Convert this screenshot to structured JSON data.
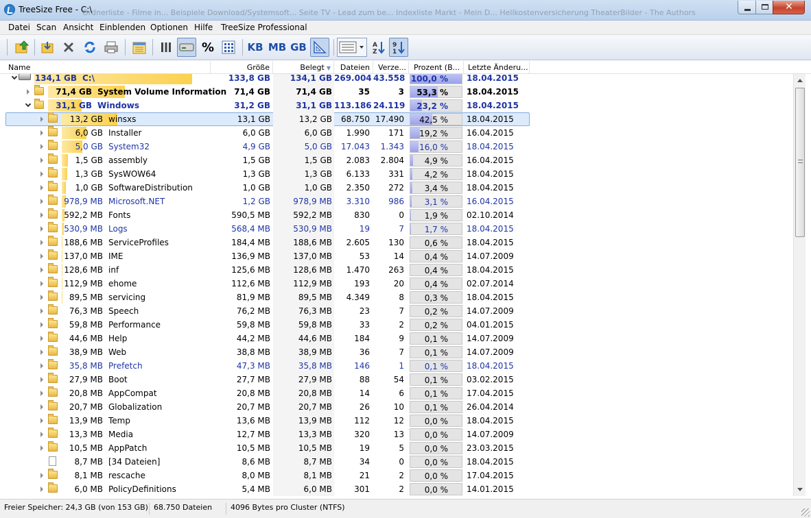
{
  "window": {
    "title": "TreeSize Free - C:\\",
    "background_tabs_text": "Ordnerliste - Filme in...    Beispiele    Download/Systemsoft...    Seite TV - Lead zum be...    Indexliste Markt - Mein D...    Hellkostenversicherung    TheaterBilder - The Authors"
  },
  "menu": [
    "Datei",
    "Scan",
    "Ansicht",
    "Einblenden",
    "Optionen",
    "Hilfe",
    "TreeSize Professional"
  ],
  "toolbar": {
    "unit_kb": "KB",
    "unit_mb": "MB",
    "unit_gb": "GB",
    "percent_label": "%"
  },
  "columns": {
    "name": "Name",
    "groesse": "Größe",
    "belegt": "Belegt",
    "dateien": "Dateien",
    "verzeichnisse": "Verze...",
    "prozent": "Prozent (B...",
    "letzte_aenderung": "Letzte Änderu..."
  },
  "rows": [
    {
      "level": 0,
      "type": "drive",
      "expander": "open",
      "size_label": "134,1 GB",
      "name": "C:\\",
      "groesse": "133,8 GB",
      "belegt": "134,1 GB",
      "dateien": "269.004",
      "verz": "43.558",
      "prozent": "100,0 %",
      "pct": 100,
      "datum": "18.04.2015",
      "bold": true,
      "blue": true,
      "bar": 100
    },
    {
      "level": 1,
      "type": "folder",
      "expander": "closed",
      "size_label": "71,4 GB",
      "name": "System Volume Information",
      "groesse": "71,4 GB",
      "belegt": "71,4 GB",
      "dateien": "35",
      "verz": "3",
      "prozent": "53,3 %",
      "pct": 53.3,
      "datum": "18.04.2015",
      "bold": true,
      "blue": false,
      "bar": 53.3
    },
    {
      "level": 1,
      "type": "folder",
      "expander": "open",
      "size_label": "31,1 GB",
      "name": "Windows",
      "groesse": "31,2 GB",
      "belegt": "31,1 GB",
      "dateien": "113.186",
      "verz": "24.119",
      "prozent": "23,2 %",
      "pct": 23.2,
      "datum": "18.04.2015",
      "bold": true,
      "blue": true,
      "bar": 23.2
    },
    {
      "level": 2,
      "type": "folder",
      "expander": "closed",
      "size_label": "13,2 GB",
      "name": "winsxs",
      "groesse": "13,1 GB",
      "belegt": "13,2 GB",
      "dateien": "68.750",
      "verz": "17.490",
      "prozent": "42,5 %",
      "pct": 42.5,
      "datum": "18.04.2015",
      "selected": true,
      "bar": 42.5
    },
    {
      "level": 2,
      "type": "folder",
      "expander": "closed",
      "size_label": "6,0 GB",
      "name": "Installer",
      "groesse": "6,0 GB",
      "belegt": "6,0 GB",
      "dateien": "1.990",
      "verz": "171",
      "prozent": "19,2 %",
      "pct": 19.2,
      "datum": "16.04.2015",
      "bar": 19.2
    },
    {
      "level": 2,
      "type": "folder",
      "expander": "closed",
      "size_label": "5,0 GB",
      "name": "System32",
      "groesse": "4,9 GB",
      "belegt": "5,0 GB",
      "dateien": "17.043",
      "verz": "1.343",
      "prozent": "16,0 %",
      "pct": 16.0,
      "datum": "18.04.2015",
      "blue": true,
      "bar": 16.0
    },
    {
      "level": 2,
      "type": "folder",
      "expander": "closed",
      "size_label": "1,5 GB",
      "name": "assembly",
      "groesse": "1,5 GB",
      "belegt": "1,5 GB",
      "dateien": "2.083",
      "verz": "2.804",
      "prozent": "4,9 %",
      "pct": 4.9,
      "datum": "16.04.2015",
      "bar": 4.9
    },
    {
      "level": 2,
      "type": "folder",
      "expander": "closed",
      "size_label": "1,3 GB",
      "name": "SysWOW64",
      "groesse": "1,3 GB",
      "belegt": "1,3 GB",
      "dateien": "6.133",
      "verz": "331",
      "prozent": "4,2 %",
      "pct": 4.2,
      "datum": "18.04.2015",
      "bar": 4.2
    },
    {
      "level": 2,
      "type": "folder",
      "expander": "closed",
      "size_label": "1,0 GB",
      "name": "SoftwareDistribution",
      "groesse": "1,0 GB",
      "belegt": "1,0 GB",
      "dateien": "2.350",
      "verz": "272",
      "prozent": "3,4 %",
      "pct": 3.4,
      "datum": "18.04.2015",
      "bar": 3.4
    },
    {
      "level": 2,
      "type": "folder",
      "expander": "closed",
      "size_label": "978,9 MB",
      "name": "Microsoft.NET",
      "groesse": "1,2 GB",
      "belegt": "978,9 MB",
      "dateien": "3.310",
      "verz": "986",
      "prozent": "3,1 %",
      "pct": 3.1,
      "datum": "16.04.2015",
      "blue": true,
      "bar": 3.1
    },
    {
      "level": 2,
      "type": "folder",
      "expander": "closed",
      "size_label": "592,2 MB",
      "name": "Fonts",
      "groesse": "590,5 MB",
      "belegt": "592,2 MB",
      "dateien": "830",
      "verz": "0",
      "prozent": "1,9 %",
      "pct": 1.9,
      "datum": "02.10.2014",
      "bar": 1.9
    },
    {
      "level": 2,
      "type": "folder",
      "expander": "closed",
      "size_label": "530,9 MB",
      "name": "Logs",
      "groesse": "568,4 MB",
      "belegt": "530,9 MB",
      "dateien": "19",
      "verz": "7",
      "prozent": "1,7 %",
      "pct": 1.7,
      "datum": "18.04.2015",
      "blue": true,
      "bar": 1.7
    },
    {
      "level": 2,
      "type": "folder",
      "expander": "closed",
      "size_label": "188,6 MB",
      "name": "ServiceProfiles",
      "groesse": "184,4 MB",
      "belegt": "188,6 MB",
      "dateien": "2.605",
      "verz": "130",
      "prozent": "0,6 %",
      "pct": 0.6,
      "datum": "18.04.2015",
      "bar": 0.6
    },
    {
      "level": 2,
      "type": "folder",
      "expander": "closed",
      "size_label": "137,0 MB",
      "name": "IME",
      "groesse": "136,9 MB",
      "belegt": "137,0 MB",
      "dateien": "53",
      "verz": "14",
      "prozent": "0,4 %",
      "pct": 0.4,
      "datum": "14.07.2009",
      "bar": 0.4
    },
    {
      "level": 2,
      "type": "folder",
      "expander": "closed",
      "size_label": "128,6 MB",
      "name": "inf",
      "groesse": "125,6 MB",
      "belegt": "128,6 MB",
      "dateien": "1.470",
      "verz": "263",
      "prozent": "0,4 %",
      "pct": 0.4,
      "datum": "18.04.2015",
      "bar": 0.4
    },
    {
      "level": 2,
      "type": "folder",
      "expander": "closed",
      "size_label": "112,9 MB",
      "name": "ehome",
      "groesse": "112,6 MB",
      "belegt": "112,9 MB",
      "dateien": "193",
      "verz": "20",
      "prozent": "0,4 %",
      "pct": 0.4,
      "datum": "02.07.2014",
      "bar": 0.4
    },
    {
      "level": 2,
      "type": "folder",
      "expander": "closed",
      "size_label": "89,5 MB",
      "name": "servicing",
      "groesse": "81,9 MB",
      "belegt": "89,5 MB",
      "dateien": "4.349",
      "verz": "8",
      "prozent": "0,3 %",
      "pct": 0.3,
      "datum": "18.04.2015",
      "bar": 0.3
    },
    {
      "level": 2,
      "type": "folder",
      "expander": "closed",
      "size_label": "76,3 MB",
      "name": "Speech",
      "groesse": "76,2 MB",
      "belegt": "76,3 MB",
      "dateien": "23",
      "verz": "7",
      "prozent": "0,2 %",
      "pct": 0.2,
      "datum": "14.07.2009",
      "bar": 0.2
    },
    {
      "level": 2,
      "type": "folder",
      "expander": "closed",
      "size_label": "59,8 MB",
      "name": "Performance",
      "groesse": "59,8 MB",
      "belegt": "59,8 MB",
      "dateien": "33",
      "verz": "2",
      "prozent": "0,2 %",
      "pct": 0.2,
      "datum": "04.01.2015",
      "bar": 0.2
    },
    {
      "level": 2,
      "type": "folder",
      "expander": "closed",
      "size_label": "44,6 MB",
      "name": "Help",
      "groesse": "44,2 MB",
      "belegt": "44,6 MB",
      "dateien": "184",
      "verz": "9",
      "prozent": "0,1 %",
      "pct": 0.1,
      "datum": "14.07.2009",
      "bar": 0.1
    },
    {
      "level": 2,
      "type": "folder",
      "expander": "closed",
      "size_label": "38,9 MB",
      "name": "Web",
      "groesse": "38,8 MB",
      "belegt": "38,9 MB",
      "dateien": "36",
      "verz": "7",
      "prozent": "0,1 %",
      "pct": 0.1,
      "datum": "14.07.2009",
      "bar": 0.1
    },
    {
      "level": 2,
      "type": "folder",
      "expander": "closed",
      "size_label": "35,8 MB",
      "name": "Prefetch",
      "groesse": "47,3 MB",
      "belegt": "35,8 MB",
      "dateien": "146",
      "verz": "1",
      "prozent": "0,1 %",
      "pct": 0.1,
      "datum": "18.04.2015",
      "blue": true,
      "bar": 0.1
    },
    {
      "level": 2,
      "type": "folder",
      "expander": "closed",
      "size_label": "27,9 MB",
      "name": "Boot",
      "groesse": "27,7 MB",
      "belegt": "27,9 MB",
      "dateien": "88",
      "verz": "54",
      "prozent": "0,1 %",
      "pct": 0.1,
      "datum": "03.02.2015",
      "bar": 0.1
    },
    {
      "level": 2,
      "type": "folder",
      "expander": "closed",
      "size_label": "20,8 MB",
      "name": "AppCompat",
      "groesse": "20,8 MB",
      "belegt": "20,8 MB",
      "dateien": "14",
      "verz": "6",
      "prozent": "0,1 %",
      "pct": 0.1,
      "datum": "17.04.2015",
      "bar": 0.1
    },
    {
      "level": 2,
      "type": "folder",
      "expander": "closed",
      "size_label": "20,7 MB",
      "name": "Globalization",
      "groesse": "20,7 MB",
      "belegt": "20,7 MB",
      "dateien": "26",
      "verz": "10",
      "prozent": "0,1 %",
      "pct": 0.1,
      "datum": "26.04.2014",
      "bar": 0.1
    },
    {
      "level": 2,
      "type": "folder",
      "expander": "closed",
      "size_label": "13,9 MB",
      "name": "Temp",
      "groesse": "13,6 MB",
      "belegt": "13,9 MB",
      "dateien": "112",
      "verz": "12",
      "prozent": "0,0 %",
      "pct": 0.0,
      "datum": "18.04.2015",
      "bar": 0.0
    },
    {
      "level": 2,
      "type": "folder",
      "expander": "closed",
      "size_label": "13,3 MB",
      "name": "Media",
      "groesse": "12,7 MB",
      "belegt": "13,3 MB",
      "dateien": "320",
      "verz": "13",
      "prozent": "0,0 %",
      "pct": 0.0,
      "datum": "14.07.2009",
      "bar": 0.0
    },
    {
      "level": 2,
      "type": "folder",
      "expander": "closed",
      "size_label": "10,5 MB",
      "name": "AppPatch",
      "groesse": "10,5 MB",
      "belegt": "10,5 MB",
      "dateien": "19",
      "verz": "5",
      "prozent": "0,0 %",
      "pct": 0.0,
      "datum": "23.03.2015",
      "bar": 0.0
    },
    {
      "level": 2,
      "type": "file",
      "expander": "none",
      "size_label": "8,7 MB",
      "name": "[34 Dateien]",
      "groesse": "8,6 MB",
      "belegt": "8,7 MB",
      "dateien": "34",
      "verz": "0",
      "prozent": "0,0 %",
      "pct": 0.0,
      "datum": "18.04.2015",
      "bar": 0.0
    },
    {
      "level": 2,
      "type": "folder",
      "expander": "closed",
      "size_label": "8,1 MB",
      "name": "rescache",
      "groesse": "8,0 MB",
      "belegt": "8,1 MB",
      "dateien": "21",
      "verz": "2",
      "prozent": "0,0 %",
      "pct": 0.0,
      "datum": "17.04.2015",
      "bar": 0.0
    },
    {
      "level": 2,
      "type": "folder",
      "expander": "closed",
      "size_label": "6,0 MB",
      "name": "PolicyDefinitions",
      "groesse": "5,4 MB",
      "belegt": "6,0 MB",
      "dateien": "301",
      "verz": "2",
      "prozent": "0,0 %",
      "pct": 0.0,
      "datum": "14.01.2015",
      "bar": 0.0
    }
  ],
  "status": {
    "free_space": "Freier Speicher: 24,3 GB  (von 153 GB)",
    "files": "68.750  Dateien",
    "cluster": "4096 Bytes pro Cluster (NTFS)"
  },
  "colors": {
    "blue_text": "#1f35a5",
    "size_bar": "#fcd14f",
    "percent_bar": "#9aa2ea",
    "selection": "#dcebfc"
  }
}
